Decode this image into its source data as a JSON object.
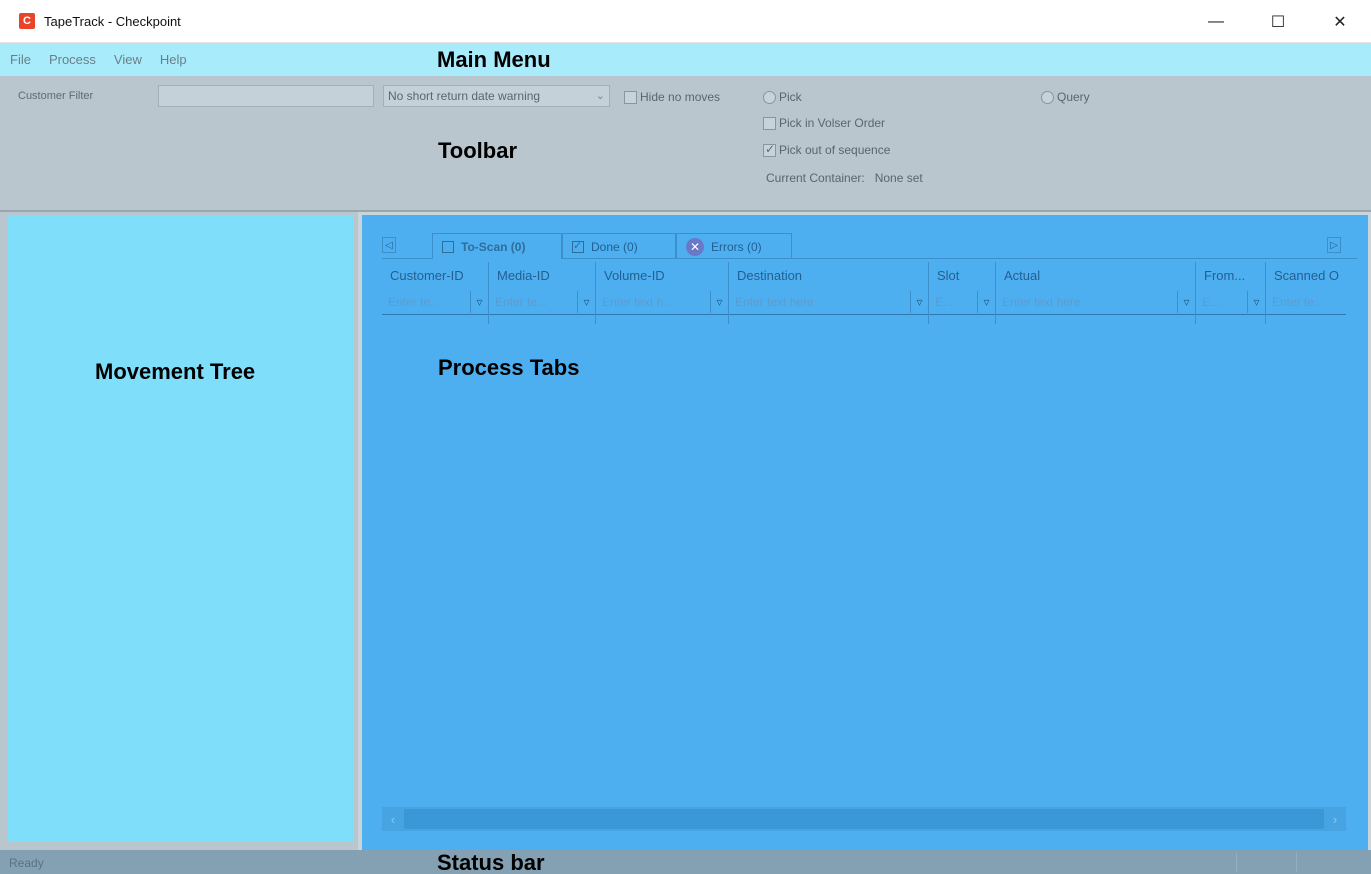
{
  "window": {
    "title": "TapeTrack - Checkpoint",
    "app_icon_letter": "C"
  },
  "window_controls": {
    "minimize": "—",
    "maximize": "☐",
    "close": "✕"
  },
  "menu": [
    "File",
    "Process",
    "View",
    "Help"
  ],
  "annotations": {
    "main_menu": "Main Menu",
    "toolbar": "Toolbar",
    "movement_tree": "Movement Tree",
    "process_tabs": "Process Tabs",
    "status_bar": "Status bar"
  },
  "toolbar": {
    "customer_filter_label": "Customer Filter",
    "customer_filter_value": "",
    "return_warning_select": "No short return date warning",
    "hide_no_moves": {
      "label": "Hide no moves",
      "checked": false
    },
    "pick": {
      "label": "Pick",
      "selected": false
    },
    "query": {
      "label": "Query",
      "selected": false
    },
    "pick_in_volser_order": {
      "label": "Pick in Volser Order",
      "checked": false
    },
    "pick_out_of_sequence": {
      "label": "Pick out of sequence",
      "checked": true
    },
    "current_container_label": "Current Container:",
    "current_container_value": "None set"
  },
  "tabs": [
    {
      "label": "To-Scan (0)",
      "icon": "checkbox-icon",
      "active": true
    },
    {
      "label": "Done (0)",
      "icon": "checked-box-icon",
      "active": false
    },
    {
      "label": "Errors (0)",
      "icon": "error-icon",
      "active": false
    }
  ],
  "columns": [
    {
      "header": "Customer-ID",
      "filter": "Enter te..."
    },
    {
      "header": "Media-ID",
      "filter": "Enter te..."
    },
    {
      "header": "Volume-ID",
      "filter": "Enter text h..."
    },
    {
      "header": "Destination",
      "filter": "Enter text here"
    },
    {
      "header": "Slot",
      "filter": "E..."
    },
    {
      "header": "Actual",
      "filter": "Enter text here"
    },
    {
      "header": "From...",
      "filter": "E..."
    },
    {
      "header": "Scanned O",
      "filter": "Enter te..."
    }
  ],
  "status": {
    "text": "Ready"
  }
}
